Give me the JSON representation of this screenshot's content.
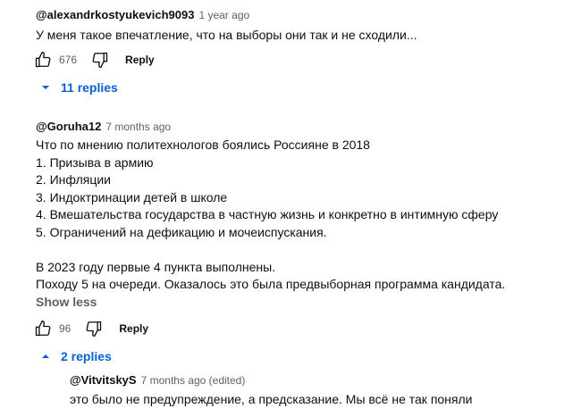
{
  "comments": [
    {
      "author": "@alexandrkostyukevich9093",
      "time": "1 year ago",
      "text": "У меня такое впечатление, что на выборы они так и не сходили...",
      "likes": "676",
      "reply_label": "Reply",
      "replies_label": "11 replies",
      "replies_expanded": false
    },
    {
      "author": "@Goruha12",
      "time": "7 months ago",
      "lines": [
        "Что по мнению политехнологов боялись Россияне в 2018",
        "1. Призыва в армию",
        "2. Инфляции",
        "3. Индоктринации детей в школе",
        "4. Вмешательства государства в частную жизнь и конкретно в интимную сферу",
        "5. Ограничений на дефикацию и мочеиспускания.",
        "",
        "В 2023 году первые 4 пункта выполнены.",
        "Походу 5 на очереди. Оказалось это была предвыборная программа кандидата."
      ],
      "show_less_label": "Show less",
      "likes": "96",
      "reply_label": "Reply",
      "replies_label": "2 replies",
      "replies_expanded": true
    }
  ],
  "reply": {
    "author": "@VitvitskyS",
    "time": "7 months ago (edited)",
    "text": "это было не предупреждение, а предсказание. Мы всё не так поняли"
  },
  "colors": {
    "link_blue": "#065fd4",
    "secondary_text": "#606060"
  },
  "icons": [
    "thumbs-up-icon",
    "thumbs-down-icon",
    "chevron-down-icon",
    "chevron-up-icon"
  ]
}
